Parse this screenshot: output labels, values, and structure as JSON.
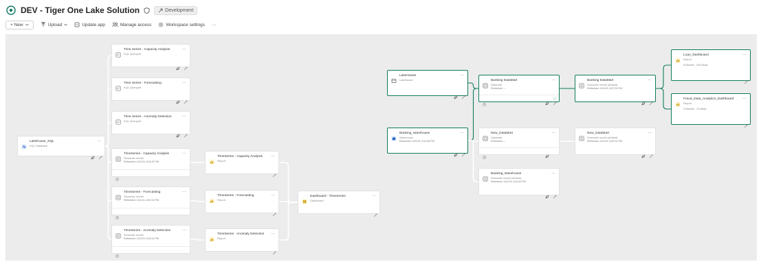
{
  "header": {
    "title": "DEV - Tiger One Lake Solution",
    "badge": "Development"
  },
  "toolbar": {
    "new": "+ New",
    "upload": "Upload",
    "update_app": "Update app",
    "manage_access": "Manage access",
    "workspace_settings": "Workspace settings",
    "more": "···"
  },
  "colors": {
    "accent": "#0f7a5c",
    "canvas": "#ececec",
    "connector": "#ffffff",
    "active_connector": "#0f7a5c"
  },
  "cards": [
    {
      "id": "lakehouse-sql",
      "title": "Lakehouse_SQL",
      "type": "KQL Database",
      "icon": "kql-database-icon",
      "footer": "leaf",
      "highlight": false
    },
    {
      "id": "ts-capacity-qs",
      "title": "Time Series - Capacity Analysis",
      "type": "KQL Queryset",
      "icon": "queryset-icon",
      "footer": "leaf",
      "highlight": false
    },
    {
      "id": "ts-forecasting-qs",
      "title": "Time Series - Forecasting",
      "type": "KQL Queryset",
      "icon": "queryset-icon",
      "footer": "leaf",
      "highlight": false
    },
    {
      "id": "ts-anomaly-qs",
      "title": "Time Series - Anomaly Detection",
      "type": "KQL Queryset",
      "icon": "queryset-icon",
      "footer": "leaf",
      "highlight": false
    },
    {
      "id": "ts-capacity-sm",
      "title": "TimeSeries - Capacity Analysis",
      "type": "Semantic model",
      "refreshed": "Refreshed: 10/1/24, 8:14:20 PM",
      "icon": "semantic-model-icon",
      "footer": "clock",
      "highlight": false
    },
    {
      "id": "ts-forecasting-sm",
      "title": "TimeSeries - Forecasting",
      "type": "Semantic model",
      "refreshed": "Refreshed: 10/1/24, 8:02:32 PM",
      "icon": "semantic-model-icon",
      "footer": "clock",
      "highlight": false
    },
    {
      "id": "ts-anomaly-sm",
      "title": "TimeSeries - Anomaly Detection",
      "type": "Semantic model",
      "refreshed": "Refreshed: 10/1/24, 8:16:31 PM",
      "icon": "semantic-model-icon",
      "footer": "clock",
      "highlight": false
    },
    {
      "id": "ts-capacity-rpt",
      "title": "TimeSeries - Capacity Analysis",
      "type": "Report",
      "icon": "report-icon",
      "footer": "wand",
      "highlight": false
    },
    {
      "id": "ts-forecasting-rpt",
      "title": "TimeSeries - Forecasting",
      "type": "Report",
      "icon": "report-icon",
      "footer": "wand",
      "highlight": false
    },
    {
      "id": "ts-anomaly-rpt",
      "title": "TimeSeries - Anomaly Detection",
      "type": "Report",
      "icon": "report-icon",
      "footer": "wand",
      "highlight": false
    },
    {
      "id": "dashboard-ts",
      "title": "Dashboard - TimeSeries",
      "type": "Dashboard",
      "icon": "dashboard-icon",
      "footer": "wand",
      "highlight": false
    },
    {
      "id": "lakehouse",
      "title": "LakeHouse",
      "type": "Lakehouse",
      "icon": "lakehouse-icon",
      "footer": "leaf",
      "highlight": true
    },
    {
      "id": "banking-wh",
      "title": "Banking_Warehouse",
      "type": "Warehouse",
      "refreshed": "Refreshed: 10/1/24, 8:14:56 PM",
      "icon": "warehouse-icon",
      "footer": "leaf",
      "highlight": true
    },
    {
      "id": "banking-datamart",
      "title": "Banking DataMart",
      "type": "Datamart",
      "refreshed": "Refreshed: --",
      "icon": "datamart-icon",
      "footer": "clock-leaf-wand",
      "highlight": true
    },
    {
      "id": "new-datamart",
      "title": "New_DataMart",
      "type": "Datamart",
      "refreshed": "Refreshed: --",
      "icon": "datamart-icon",
      "footer": "clock-leaf",
      "highlight": false
    },
    {
      "id": "banking-wh-sm",
      "title": "Banking_Warehouse",
      "type": "Semantic model (default)",
      "refreshed": "Refreshed: 10/1/24, 8:14:49 PM",
      "icon": "semantic-model-icon",
      "footer": "leaf",
      "highlight": false
    },
    {
      "id": "banking-datamart-sm",
      "title": "Banking DataMart",
      "type": "Semantic model (default)",
      "refreshed": "Refreshed: 10/1/24, 8:07:16 PM",
      "icon": "semantic-model-icon",
      "footer": "leaf",
      "highlight": true
    },
    {
      "id": "new-datamart-sm",
      "title": "New_DataMart",
      "type": "Semantic model (default)",
      "refreshed": "Refreshed: 10/1/24, 8:02:31 PM",
      "icon": "semantic-model-icon",
      "footer": "leaf",
      "highlight": false
    },
    {
      "id": "loan-dashboard",
      "title": "Loan_Dashboard",
      "type": "Report",
      "stats": "8 Viewers   ·   103 Views",
      "icon": "report-icon",
      "footer": "wand",
      "highlight": true
    },
    {
      "id": "fraud-dashboard",
      "title": "Fraud_Data_Analytics_Dashboard",
      "type": "Report",
      "stats": "3 Viewers   ·   74 Views",
      "icon": "report-icon",
      "footer": "wand",
      "highlight": true
    }
  ]
}
